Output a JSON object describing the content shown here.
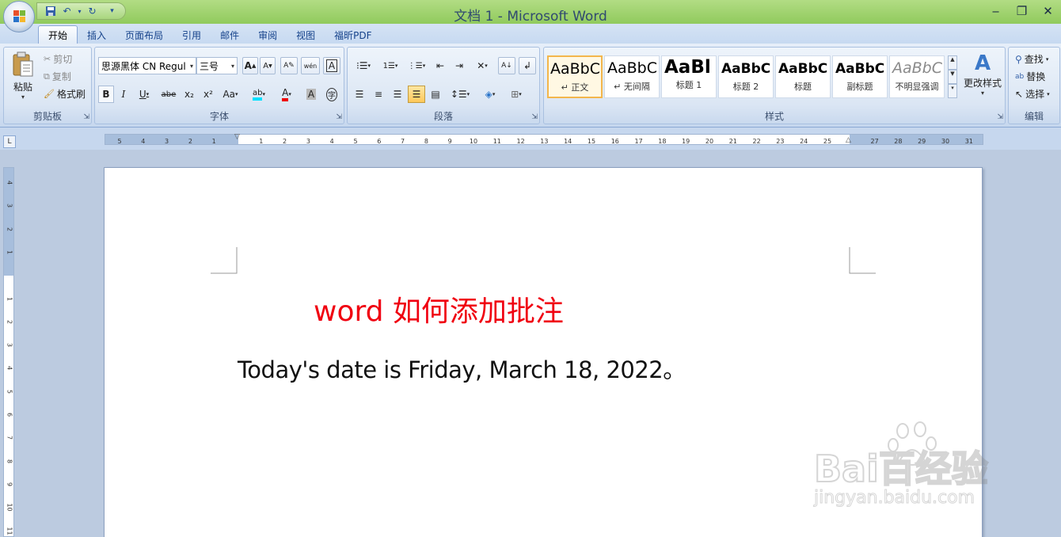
{
  "window": {
    "title": "文档 1 - Microsoft Word"
  },
  "quick_access": {
    "icons": [
      "save-icon",
      "undo-icon",
      "redo-icon",
      "customize-icon"
    ]
  },
  "tabs": [
    {
      "label": "开始",
      "active": true
    },
    {
      "label": "插入"
    },
    {
      "label": "页面布局"
    },
    {
      "label": "引用"
    },
    {
      "label": "邮件"
    },
    {
      "label": "审阅"
    },
    {
      "label": "视图"
    },
    {
      "label": "福昕PDF"
    }
  ],
  "ribbon": {
    "clipboard": {
      "group_label": "剪贴板",
      "paste": "粘贴",
      "cut": "剪切",
      "copy": "复制",
      "format_painter": "格式刷"
    },
    "font": {
      "group_label": "字体",
      "font_name": "思源黑体 CN Regul",
      "font_size": "三号",
      "grow": "A",
      "shrink": "A",
      "bold": "B",
      "italic": "I",
      "underline": "U",
      "strike": "abe",
      "subscript": "x₂",
      "superscript": "x²",
      "change_case": "Aa",
      "phonetic": "wén",
      "char_border": "A",
      "char_shade": "A",
      "enclose": "字"
    },
    "paragraph": {
      "group_label": "段落"
    },
    "styles": {
      "group_label": "样式",
      "change_styles": "更改样式",
      "items": [
        {
          "sample": "AaBbC",
          "name": "↵ 正文"
        },
        {
          "sample": "AaBbC",
          "name": "↵ 无间隔"
        },
        {
          "sample": "AaBl",
          "name": "标题 1"
        },
        {
          "sample": "AaBbC",
          "name": "标题 2"
        },
        {
          "sample": "AaBbC",
          "name": "标题"
        },
        {
          "sample": "AaBbC",
          "name": "副标题"
        },
        {
          "sample": "AaBbC",
          "name": "不明显强调"
        }
      ]
    },
    "editing": {
      "group_label": "编辑",
      "find": "查找",
      "replace": "替换",
      "select": "选择"
    }
  },
  "ruler": {
    "horizontal_ticks": [
      "5",
      "4",
      "3",
      "2",
      "1",
      "",
      "1",
      "2",
      "3",
      "4",
      "5",
      "6",
      "7",
      "8",
      "9",
      "10",
      "11",
      "12",
      "13",
      "14",
      "15",
      "16",
      "17",
      "18",
      "19",
      "20",
      "21",
      "22",
      "23",
      "24",
      "25",
      "",
      "27",
      "28",
      "29",
      "30",
      "31"
    ],
    "vertical_ticks": [
      "4",
      "3",
      "2",
      "1",
      "",
      "1",
      "2",
      "3",
      "4",
      "5",
      "6",
      "7",
      "8",
      "9",
      "10",
      "11"
    ]
  },
  "document": {
    "title": "word 如何添加批注",
    "body": "Today's date is Friday, March 18, 2022。"
  },
  "watermark": {
    "main": "Bai百经验",
    "sub": "jingyan.baidu.com"
  },
  "colors": {
    "title_bar": "#9fd36d",
    "doc_title": "#f00010",
    "ribbon": "#dbe6f4"
  }
}
